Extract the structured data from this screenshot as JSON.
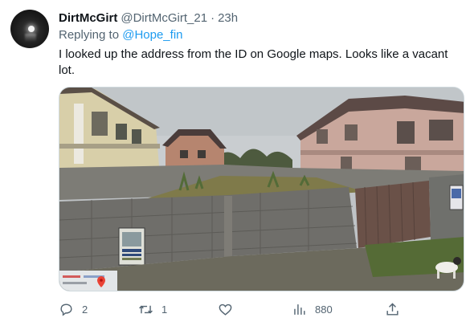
{
  "author": {
    "display_name": "DirtMcGirt",
    "handle": "@DirtMcGirt_21",
    "separator": "·",
    "time": "23h",
    "avatar_icon": "moon-night-avatar"
  },
  "reply": {
    "prefix": "Replying to",
    "mention": "@Hope_fin"
  },
  "body": {
    "text": "I looked up the address from the ID on Google maps. Looks like a vacant lot."
  },
  "media": {
    "kind": "street-view-photo",
    "icons": [
      "street-view-location-pin-icon"
    ]
  },
  "actions": {
    "reply_count": "2",
    "retweet_count": "1",
    "like_count": "",
    "views_count": "880",
    "icons": [
      "reply-icon",
      "retweet-icon",
      "like-icon",
      "views-icon",
      "share-icon"
    ]
  },
  "colors": {
    "text": "#0f1419",
    "secondary": "#536471",
    "link": "#1d9bf0",
    "border": "#cfd9de"
  }
}
